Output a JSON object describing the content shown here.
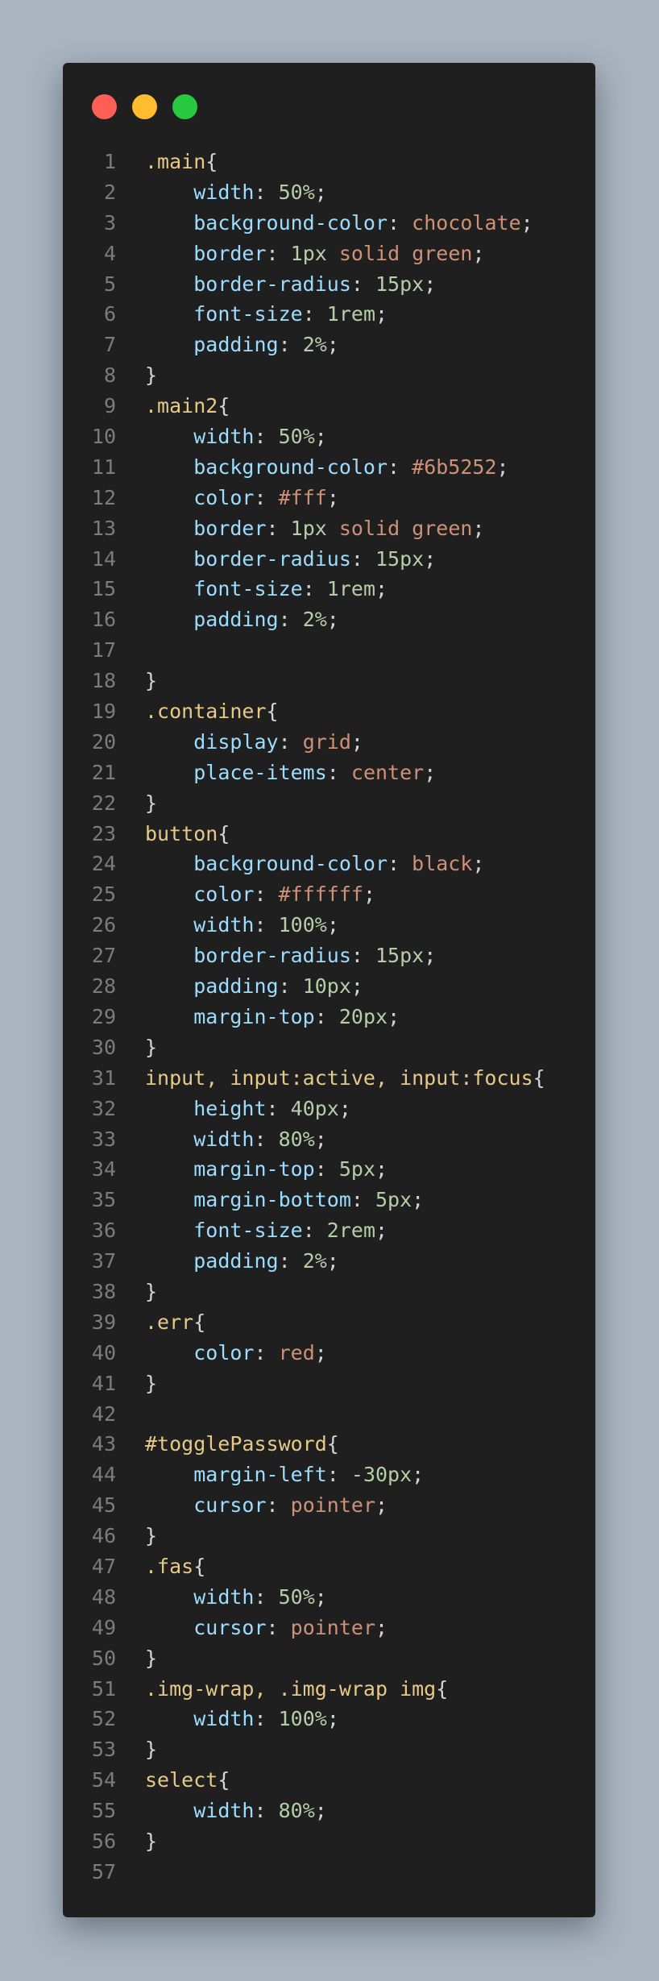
{
  "window": {
    "controls": [
      {
        "name": "close",
        "color": "#ff5f57"
      },
      {
        "name": "minimize",
        "color": "#febc2e"
      },
      {
        "name": "maximize",
        "color": "#28c840"
      }
    ]
  },
  "code": {
    "language": "css",
    "lines": [
      [
        {
          "t": ".main",
          "c": "selector"
        },
        {
          "t": "{",
          "c": "punct"
        }
      ],
      [
        {
          "t": "    "
        },
        {
          "t": "width",
          "c": "prop"
        },
        {
          "t": ": ",
          "c": "punct"
        },
        {
          "t": "50%",
          "c": "number"
        },
        {
          "t": ";",
          "c": "punct"
        }
      ],
      [
        {
          "t": "    "
        },
        {
          "t": "background-color",
          "c": "prop"
        },
        {
          "t": ": ",
          "c": "punct"
        },
        {
          "t": "chocolate",
          "c": "value"
        },
        {
          "t": ";",
          "c": "punct"
        }
      ],
      [
        {
          "t": "    "
        },
        {
          "t": "border",
          "c": "prop"
        },
        {
          "t": ": ",
          "c": "punct"
        },
        {
          "t": "1px",
          "c": "number"
        },
        {
          "t": " "
        },
        {
          "t": "solid",
          "c": "value"
        },
        {
          "t": " "
        },
        {
          "t": "green",
          "c": "value"
        },
        {
          "t": ";",
          "c": "punct"
        }
      ],
      [
        {
          "t": "    "
        },
        {
          "t": "border-radius",
          "c": "prop"
        },
        {
          "t": ": ",
          "c": "punct"
        },
        {
          "t": "15px",
          "c": "number"
        },
        {
          "t": ";",
          "c": "punct"
        }
      ],
      [
        {
          "t": "    "
        },
        {
          "t": "font-size",
          "c": "prop"
        },
        {
          "t": ": ",
          "c": "punct"
        },
        {
          "t": "1rem",
          "c": "number"
        },
        {
          "t": ";",
          "c": "punct"
        }
      ],
      [
        {
          "t": "    "
        },
        {
          "t": "padding",
          "c": "prop"
        },
        {
          "t": ": ",
          "c": "punct"
        },
        {
          "t": "2%",
          "c": "number"
        },
        {
          "t": ";",
          "c": "punct"
        }
      ],
      [
        {
          "t": "}",
          "c": "punct"
        }
      ],
      [
        {
          "t": ".main2",
          "c": "selector"
        },
        {
          "t": "{",
          "c": "punct"
        }
      ],
      [
        {
          "t": "    "
        },
        {
          "t": "width",
          "c": "prop"
        },
        {
          "t": ": ",
          "c": "punct"
        },
        {
          "t": "50%",
          "c": "number"
        },
        {
          "t": ";",
          "c": "punct"
        }
      ],
      [
        {
          "t": "    "
        },
        {
          "t": "background-color",
          "c": "prop"
        },
        {
          "t": ": ",
          "c": "punct"
        },
        {
          "t": "#6b5252",
          "c": "value"
        },
        {
          "t": ";",
          "c": "punct"
        }
      ],
      [
        {
          "t": "    "
        },
        {
          "t": "color",
          "c": "prop"
        },
        {
          "t": ": ",
          "c": "punct"
        },
        {
          "t": "#fff",
          "c": "value"
        },
        {
          "t": ";",
          "c": "punct"
        }
      ],
      [
        {
          "t": "    "
        },
        {
          "t": "border",
          "c": "prop"
        },
        {
          "t": ": ",
          "c": "punct"
        },
        {
          "t": "1px",
          "c": "number"
        },
        {
          "t": " "
        },
        {
          "t": "solid",
          "c": "value"
        },
        {
          "t": " "
        },
        {
          "t": "green",
          "c": "value"
        },
        {
          "t": ";",
          "c": "punct"
        }
      ],
      [
        {
          "t": "    "
        },
        {
          "t": "border-radius",
          "c": "prop"
        },
        {
          "t": ": ",
          "c": "punct"
        },
        {
          "t": "15px",
          "c": "number"
        },
        {
          "t": ";",
          "c": "punct"
        }
      ],
      [
        {
          "t": "    "
        },
        {
          "t": "font-size",
          "c": "prop"
        },
        {
          "t": ": ",
          "c": "punct"
        },
        {
          "t": "1rem",
          "c": "number"
        },
        {
          "t": ";",
          "c": "punct"
        }
      ],
      [
        {
          "t": "    "
        },
        {
          "t": "padding",
          "c": "prop"
        },
        {
          "t": ": ",
          "c": "punct"
        },
        {
          "t": "2%",
          "c": "number"
        },
        {
          "t": ";",
          "c": "punct"
        }
      ],
      [],
      [
        {
          "t": "}",
          "c": "punct"
        }
      ],
      [
        {
          "t": ".container",
          "c": "selector"
        },
        {
          "t": "{",
          "c": "punct"
        }
      ],
      [
        {
          "t": "    "
        },
        {
          "t": "display",
          "c": "prop"
        },
        {
          "t": ": ",
          "c": "punct"
        },
        {
          "t": "grid",
          "c": "value"
        },
        {
          "t": ";",
          "c": "punct"
        }
      ],
      [
        {
          "t": "    "
        },
        {
          "t": "place-items",
          "c": "prop"
        },
        {
          "t": ": ",
          "c": "punct"
        },
        {
          "t": "center",
          "c": "value"
        },
        {
          "t": ";",
          "c": "punct"
        }
      ],
      [
        {
          "t": "}",
          "c": "punct"
        }
      ],
      [
        {
          "t": "button",
          "c": "selector"
        },
        {
          "t": "{",
          "c": "punct"
        }
      ],
      [
        {
          "t": "    "
        },
        {
          "t": "background-color",
          "c": "prop"
        },
        {
          "t": ": ",
          "c": "punct"
        },
        {
          "t": "black",
          "c": "value"
        },
        {
          "t": ";",
          "c": "punct"
        }
      ],
      [
        {
          "t": "    "
        },
        {
          "t": "color",
          "c": "prop"
        },
        {
          "t": ": ",
          "c": "punct"
        },
        {
          "t": "#ffffff",
          "c": "value"
        },
        {
          "t": ";",
          "c": "punct"
        }
      ],
      [
        {
          "t": "    "
        },
        {
          "t": "width",
          "c": "prop"
        },
        {
          "t": ": ",
          "c": "punct"
        },
        {
          "t": "100%",
          "c": "number"
        },
        {
          "t": ";",
          "c": "punct"
        }
      ],
      [
        {
          "t": "    "
        },
        {
          "t": "border-radius",
          "c": "prop"
        },
        {
          "t": ": ",
          "c": "punct"
        },
        {
          "t": "15px",
          "c": "number"
        },
        {
          "t": ";",
          "c": "punct"
        }
      ],
      [
        {
          "t": "    "
        },
        {
          "t": "padding",
          "c": "prop"
        },
        {
          "t": ": ",
          "c": "punct"
        },
        {
          "t": "10px",
          "c": "number"
        },
        {
          "t": ";",
          "c": "punct"
        }
      ],
      [
        {
          "t": "    "
        },
        {
          "t": "margin-top",
          "c": "prop"
        },
        {
          "t": ": ",
          "c": "punct"
        },
        {
          "t": "20px",
          "c": "number"
        },
        {
          "t": ";",
          "c": "punct"
        }
      ],
      [
        {
          "t": "}",
          "c": "punct"
        }
      ],
      [
        {
          "t": "input, input:active, input:focus",
          "c": "selector"
        },
        {
          "t": "{",
          "c": "punct"
        }
      ],
      [
        {
          "t": "    "
        },
        {
          "t": "height",
          "c": "prop"
        },
        {
          "t": ": ",
          "c": "punct"
        },
        {
          "t": "40px",
          "c": "number"
        },
        {
          "t": ";",
          "c": "punct"
        }
      ],
      [
        {
          "t": "    "
        },
        {
          "t": "width",
          "c": "prop"
        },
        {
          "t": ": ",
          "c": "punct"
        },
        {
          "t": "80%",
          "c": "number"
        },
        {
          "t": ";",
          "c": "punct"
        }
      ],
      [
        {
          "t": "    "
        },
        {
          "t": "margin-top",
          "c": "prop"
        },
        {
          "t": ": ",
          "c": "punct"
        },
        {
          "t": "5px",
          "c": "number"
        },
        {
          "t": ";",
          "c": "punct"
        }
      ],
      [
        {
          "t": "    "
        },
        {
          "t": "margin-bottom",
          "c": "prop"
        },
        {
          "t": ": ",
          "c": "punct"
        },
        {
          "t": "5px",
          "c": "number"
        },
        {
          "t": ";",
          "c": "punct"
        }
      ],
      [
        {
          "t": "    "
        },
        {
          "t": "font-size",
          "c": "prop"
        },
        {
          "t": ": ",
          "c": "punct"
        },
        {
          "t": "2rem",
          "c": "number"
        },
        {
          "t": ";",
          "c": "punct"
        }
      ],
      [
        {
          "t": "    "
        },
        {
          "t": "padding",
          "c": "prop"
        },
        {
          "t": ": ",
          "c": "punct"
        },
        {
          "t": "2%",
          "c": "number"
        },
        {
          "t": ";",
          "c": "punct"
        }
      ],
      [
        {
          "t": "}",
          "c": "punct"
        }
      ],
      [
        {
          "t": ".err",
          "c": "selector"
        },
        {
          "t": "{",
          "c": "punct"
        }
      ],
      [
        {
          "t": "    "
        },
        {
          "t": "color",
          "c": "prop"
        },
        {
          "t": ": ",
          "c": "punct"
        },
        {
          "t": "red",
          "c": "value"
        },
        {
          "t": ";",
          "c": "punct"
        }
      ],
      [
        {
          "t": "}",
          "c": "punct"
        }
      ],
      [],
      [
        {
          "t": "#togglePassword",
          "c": "selector"
        },
        {
          "t": "{",
          "c": "punct"
        }
      ],
      [
        {
          "t": "    "
        },
        {
          "t": "margin-left",
          "c": "prop"
        },
        {
          "t": ": ",
          "c": "punct"
        },
        {
          "t": "-30px",
          "c": "number"
        },
        {
          "t": ";",
          "c": "punct"
        }
      ],
      [
        {
          "t": "    "
        },
        {
          "t": "cursor",
          "c": "prop"
        },
        {
          "t": ": ",
          "c": "punct"
        },
        {
          "t": "pointer",
          "c": "value"
        },
        {
          "t": ";",
          "c": "punct"
        }
      ],
      [
        {
          "t": "}",
          "c": "punct"
        }
      ],
      [
        {
          "t": ".fas",
          "c": "selector"
        },
        {
          "t": "{",
          "c": "punct"
        }
      ],
      [
        {
          "t": "    "
        },
        {
          "t": "width",
          "c": "prop"
        },
        {
          "t": ": ",
          "c": "punct"
        },
        {
          "t": "50%",
          "c": "number"
        },
        {
          "t": ";",
          "c": "punct"
        }
      ],
      [
        {
          "t": "    "
        },
        {
          "t": "cursor",
          "c": "prop"
        },
        {
          "t": ": ",
          "c": "punct"
        },
        {
          "t": "pointer",
          "c": "value"
        },
        {
          "t": ";",
          "c": "punct"
        }
      ],
      [
        {
          "t": "}",
          "c": "punct"
        }
      ],
      [
        {
          "t": ".img-wrap, .img-wrap img",
          "c": "selector"
        },
        {
          "t": "{",
          "c": "punct"
        }
      ],
      [
        {
          "t": "    "
        },
        {
          "t": "width",
          "c": "prop"
        },
        {
          "t": ": ",
          "c": "punct"
        },
        {
          "t": "100%",
          "c": "number"
        },
        {
          "t": ";",
          "c": "punct"
        }
      ],
      [
        {
          "t": "}",
          "c": "punct"
        }
      ],
      [
        {
          "t": "select",
          "c": "selector"
        },
        {
          "t": "{",
          "c": "punct"
        }
      ],
      [
        {
          "t": "    "
        },
        {
          "t": "width",
          "c": "prop"
        },
        {
          "t": ": ",
          "c": "punct"
        },
        {
          "t": "80%",
          "c": "number"
        },
        {
          "t": ";",
          "c": "punct"
        }
      ],
      [
        {
          "t": "}",
          "c": "punct"
        }
      ],
      []
    ]
  }
}
